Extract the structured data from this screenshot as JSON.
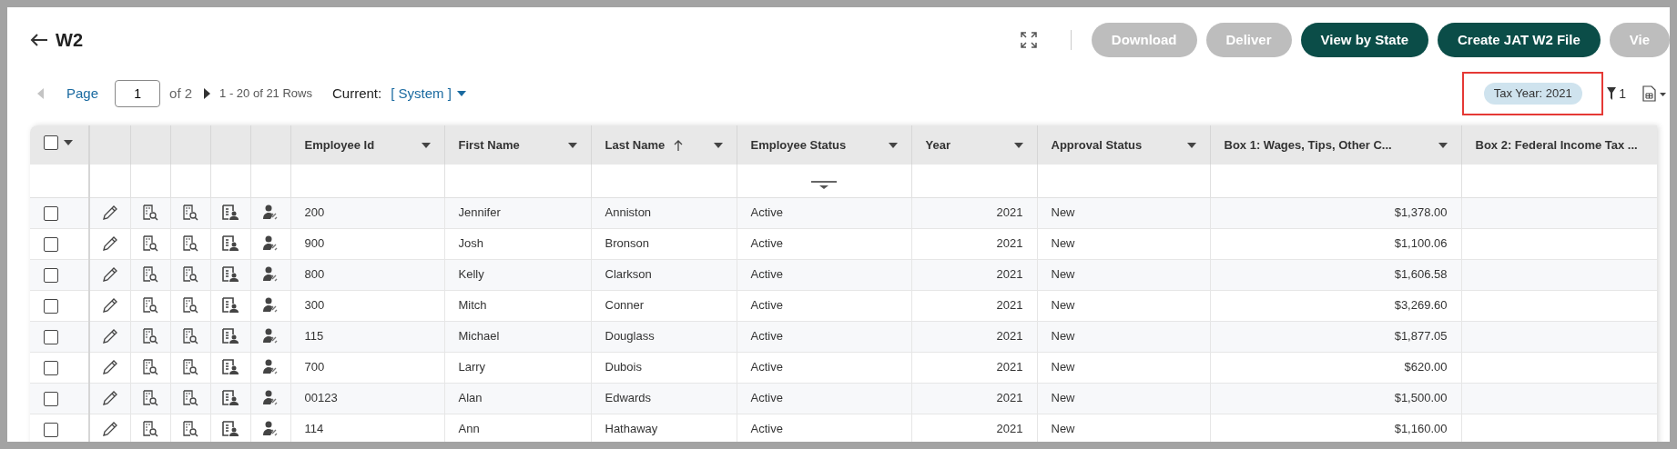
{
  "page": {
    "title": "W2"
  },
  "actions": [
    {
      "label": "Download",
      "disabled": true
    },
    {
      "label": "Deliver",
      "disabled": true
    },
    {
      "label": "View by State",
      "disabled": false
    },
    {
      "label": "Create JAT W2 File",
      "disabled": false
    },
    {
      "label": "Vie",
      "disabled": true
    }
  ],
  "pagination": {
    "page_label": "Page",
    "page": "1",
    "of": "of 2",
    "rows": "1 - 20 of 21 Rows"
  },
  "view": {
    "label": "Current:",
    "value": "[ System ]"
  },
  "filter_chip": {
    "label": "Tax Year: 2021",
    "highlighted": true
  },
  "filter_count": "1",
  "select_all": {
    "checked": false
  },
  "columns": [
    {
      "label": "Employee Id"
    },
    {
      "label": "First Name"
    },
    {
      "label": "Last Name",
      "sorted_ascending": true
    },
    {
      "label": "Employee Status"
    },
    {
      "label": "Year"
    },
    {
      "label": "Approval Status"
    },
    {
      "label": "Box 1: Wages, Tips, Other C..."
    },
    {
      "label": "Box 2: Federal Income Tax ..."
    }
  ],
  "rows": [
    {
      "checked": false,
      "cells": [
        "200",
        "Jennifer",
        "Anniston",
        "Active",
        "2021",
        "New",
        "$1,378.00"
      ]
    },
    {
      "checked": false,
      "cells": [
        "900",
        "Josh",
        "Bronson",
        "Active",
        "2021",
        "New",
        "$1,100.06"
      ]
    },
    {
      "checked": false,
      "cells": [
        "800",
        "Kelly",
        "Clarkson",
        "Active",
        "2021",
        "New",
        "$1,606.58"
      ]
    },
    {
      "checked": false,
      "cells": [
        "300",
        "Mitch",
        "Conner",
        "Active",
        "2021",
        "New",
        "$3,269.60"
      ]
    },
    {
      "checked": false,
      "cells": [
        "115",
        "Michael",
        "Douglass",
        "Active",
        "2021",
        "New",
        "$1,877.05"
      ]
    },
    {
      "checked": false,
      "cells": [
        "700",
        "Larry",
        "Dubois",
        "Active",
        "2021",
        "New",
        "$620.00"
      ]
    },
    {
      "checked": false,
      "cells": [
        "00123",
        "Alan",
        "Edwards",
        "Active",
        "2021",
        "New",
        "$1,500.00"
      ]
    },
    {
      "checked": false,
      "cells": [
        "114",
        "Ann",
        "Hathaway",
        "Active",
        "2021",
        "New",
        "$1,160.00"
      ]
    }
  ]
}
